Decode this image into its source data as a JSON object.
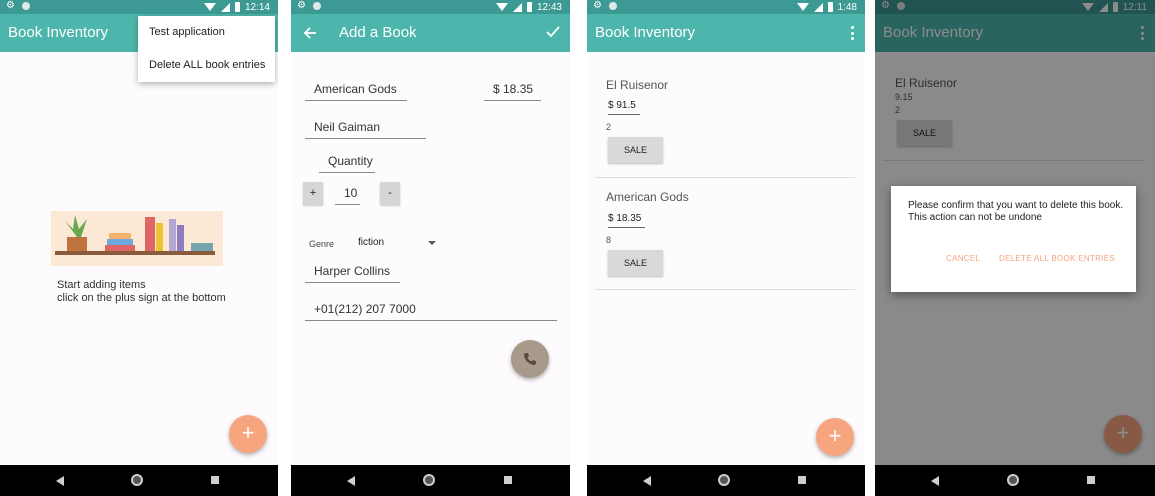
{
  "status": {
    "p1_time": "12:14",
    "p2_time": "12:43",
    "p3_time": "1:48",
    "p4_time": "12:11"
  },
  "colors": {
    "primary": "#4db6ac",
    "primary_dark": "#3d9993",
    "accent": "#f7a57f",
    "dialog_action": "#f5a37f"
  },
  "panel1": {
    "app_title": "Book Inventory",
    "menu": {
      "item1": "Test application",
      "item2": "Delete ALL book entries"
    },
    "empty_line1": "Start adding items",
    "empty_line2": "click on the plus sign at the bottom",
    "fab_label": "+",
    "fab_icon": "plus-icon"
  },
  "panel2": {
    "title": "Add a Book",
    "back_icon": "arrow-back-icon",
    "save_icon": "check-icon",
    "book_name": "American Gods",
    "price": "$ 18.35",
    "author": "Neil Gaiman",
    "quantity_label": "Quantity",
    "plus": "+",
    "quantity": "10",
    "minus": "-",
    "genre_label": "Genre",
    "genre_value": "fiction",
    "publisher": "Harper Collins",
    "phone": "+01(212) 207 7000",
    "call_icon": "phone-icon"
  },
  "panel3": {
    "app_title": "Book Inventory",
    "books": [
      {
        "name": "El Ruisenor",
        "price": "$ 91.5",
        "qty": "2",
        "sale": "SALE"
      },
      {
        "name": "American Gods",
        "price": "$ 18.35",
        "qty": "8",
        "sale": "SALE"
      }
    ],
    "fab_label": "+"
  },
  "panel4": {
    "app_title": "Book Inventory",
    "book_name": "El Ruisenor",
    "book_price": "9.15",
    "book_qty": "2",
    "sale": "SALE",
    "dialog_line1": "Please confirm that you want to delete this book.",
    "dialog_line2": "This action can not be undone",
    "cancel": "CANCEL",
    "confirm": "DELETE ALL BOOK ENTRIES",
    "fab_label": "+"
  }
}
